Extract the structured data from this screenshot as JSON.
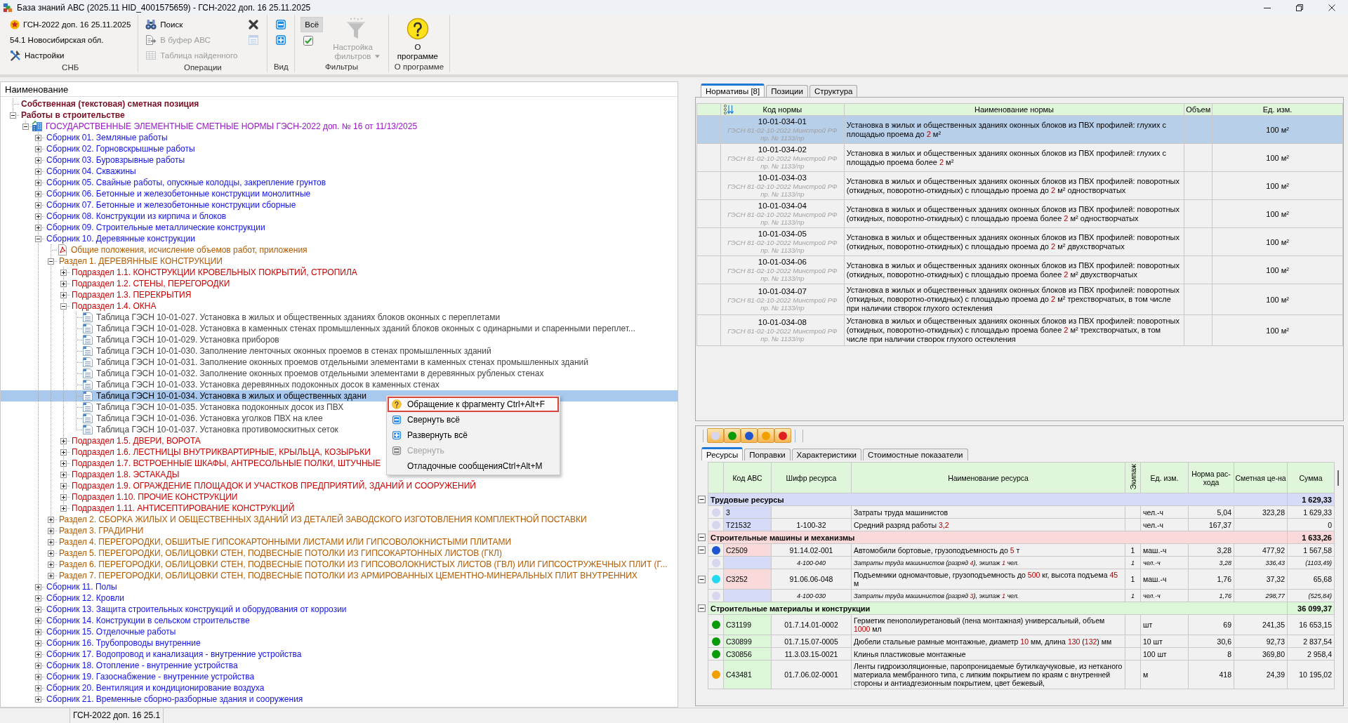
{
  "window": {
    "title": "База знаний АВС (2025.11 HID_4001575659) - ГСН-2022 доп. 16 25.11.2025"
  },
  "ribbon": {
    "groups": [
      {
        "label": "СНБ",
        "columns": [
          {
            "items": [
              {
                "kind": "info",
                "text": "ГСН-2022 доп. 16 25.11.2025",
                "disabled": false
              },
              {
                "kind": "info",
                "text": "54.1 Новосибирская обл.",
                "disabled": false
              },
              {
                "kind": "small",
                "text": "Настройки",
                "disabled": false
              }
            ]
          }
        ]
      },
      {
        "label": "Операции",
        "columns": [
          {
            "items": [
              {
                "kind": "small",
                "text": "Поиск",
                "disabled": false
              },
              {
                "kind": "small",
                "text": "В буфер АВС",
                "disabled": true
              },
              {
                "kind": "small",
                "text": "Таблица найденного",
                "disabled": true
              }
            ]
          },
          {
            "items": [
              {
                "kind": "icon",
                "disabled": false
              },
              {
                "kind": "icon",
                "disabled": true
              }
            ]
          }
        ]
      },
      {
        "label": "Вид",
        "columns": [
          {
            "items": [
              {
                "kind": "icon",
                "disabled": false
              },
              {
                "kind": "icon",
                "disabled": false
              }
            ]
          }
        ]
      },
      {
        "label": "Фильтры",
        "columns": [
          {
            "items": [
              {
                "kind": "toggle",
                "text": "Всё",
                "pressed": true,
                "disabled": false
              },
              {
                "kind": "icon",
                "disabled": false
              }
            ]
          },
          {
            "items": [
              {
                "kind": "large",
                "text": "Настройка фильтров",
                "dropdown": true,
                "disabled": true
              }
            ]
          }
        ]
      },
      {
        "label": "О программе",
        "columns": [
          {
            "items": [
              {
                "kind": "large",
                "text": "О программе",
                "dropdown": false,
                "disabled": false
              }
            ]
          }
        ]
      }
    ]
  },
  "tree": {
    "header": "Наименование",
    "items": [
      {
        "kind": "top",
        "text": "Собственная (текстовая) сметная позиция",
        "selected": false
      },
      {
        "kind": "top",
        "text": "Работы в строительстве",
        "expanded": true,
        "selected": false,
        "children": [
          {
            "kind": "norms",
            "text": "ГОСУДАРСТВЕННЫЕ ЭЛЕМЕНТНЫЕ СМЕТНЫЕ НОРМЫ ГЭСН-2022 доп. № 16 от 11/13/2025",
            "expanded": true,
            "selected": false,
            "children": [
              {
                "kind": "collection",
                "text": "Сборник 01. Земляные работы",
                "expanded": false,
                "selected": false
              },
              {
                "kind": "collection",
                "text": "Сборник 02. Горновскрышные работы",
                "expanded": false,
                "selected": false
              },
              {
                "kind": "collection",
                "text": "Сборник 03. Буровзрывные работы",
                "expanded": false,
                "selected": false
              },
              {
                "kind": "collection",
                "text": "Сборник 04. Скважины",
                "expanded": false,
                "selected": false
              },
              {
                "kind": "collection",
                "text": "Сборник 05. Свайные работы, опускные колодцы, закрепление грунтов",
                "expanded": false,
                "selected": false
              },
              {
                "kind": "collection",
                "text": "Сборник 06. Бетонные и железобетонные конструкции монолитные",
                "expanded": false,
                "selected": false
              },
              {
                "kind": "collection",
                "text": "Сборник 07. Бетонные и железобетонные конструкции сборные",
                "expanded": false,
                "selected": false
              },
              {
                "kind": "collection",
                "text": "Сборник 08. Конструкции из кирпича и блоков",
                "expanded": false,
                "selected": false
              },
              {
                "kind": "collection",
                "text": "Сборник 09. Строительные металлические конструкции",
                "expanded": false,
                "selected": false
              },
              {
                "kind": "collection",
                "text": "Сборник 10. Деревянные конструкции",
                "expanded": true,
                "selected": false,
                "children": [
                  {
                    "kind": "general",
                    "text": "Общие положения, исчисление объемов работ, приложения",
                    "selected": false
                  },
                  {
                    "kind": "section",
                    "text": "Раздел 1. ДЕРЕВЯННЫЕ КОНСТРУКЦИИ",
                    "expanded": true,
                    "selected": false,
                    "children": [
                      {
                        "kind": "subsection",
                        "text": "Подраздел 1.1. КОНСТРУКЦИИ КРОВЕЛЬНЫХ ПОКРЫТИЙ, СТРОПИЛА",
                        "expanded": false,
                        "selected": false
                      },
                      {
                        "kind": "subsection",
                        "text": "Подраздел 1.2. СТЕНЫ, ПЕРЕГОРОДКИ",
                        "expanded": false,
                        "selected": false
                      },
                      {
                        "kind": "subsection",
                        "text": "Подраздел 1.3. ПЕРЕКРЫТИЯ",
                        "expanded": false,
                        "selected": false
                      },
                      {
                        "kind": "subsection",
                        "text": "Подраздел 1.4. ОКНА",
                        "expanded": true,
                        "selected": false,
                        "children": [
                          {
                            "kind": "table",
                            "text": "Таблица ГЭСН 10-01-027. Установка в жилых и общественных зданиях блоков оконных с переплетами",
                            "selected": false
                          },
                          {
                            "kind": "table",
                            "text": "Таблица ГЭСН 10-01-028. Установка в каменных стенах промышленных зданий блоков оконных с одинарными и спаренными переплет...",
                            "selected": false
                          },
                          {
                            "kind": "table",
                            "text": "Таблица ГЭСН 10-01-029. Установка приборов",
                            "selected": false
                          },
                          {
                            "kind": "table",
                            "text": "Таблица ГЭСН 10-01-030. Заполнение ленточных оконных проемов в стенах промышленных зданий",
                            "selected": false
                          },
                          {
                            "kind": "table",
                            "text": "Таблица ГЭСН 10-01-031. Заполнение оконных проемов отдельными элементами в каменных стенах промышленных зданий",
                            "selected": false
                          },
                          {
                            "kind": "table",
                            "text": "Таблица ГЭСН 10-01-032. Заполнение оконных проемов отдельными элементами в деревянных рубленых стенах",
                            "selected": false
                          },
                          {
                            "kind": "table",
                            "text": "Таблица ГЭСН 10-01-033. Установка деревянных подоконных досок в каменных стенах",
                            "selected": false
                          },
                          {
                            "kind": "table",
                            "text": "Таблица ГЭСН 10-01-034. Установка в жилых и общественных здани",
                            "selected": true
                          },
                          {
                            "kind": "table",
                            "text": "Таблица ГЭСН 10-01-035. Установка подоконных досок из ПВХ",
                            "selected": false
                          },
                          {
                            "kind": "table",
                            "text": "Таблица ГЭСН 10-01-036. Установка уголков ПВХ на клее",
                            "selected": false
                          },
                          {
                            "kind": "table",
                            "text": "Таблица ГЭСН 10-01-037. Установка противомоскитных сеток",
                            "selected": false
                          }
                        ]
                      },
                      {
                        "kind": "subsection",
                        "text": "Подраздел 1.5. ДВЕРИ, ВОРОТА",
                        "expanded": false,
                        "selected": false
                      },
                      {
                        "kind": "subsection",
                        "text": "Подраздел 1.6. ЛЕСТНИЦЫ ВНУТРИКВАРТИРНЫЕ, КРЫЛЬЦА, КОЗЫРЬКИ",
                        "expanded": false,
                        "selected": false
                      },
                      {
                        "kind": "subsection",
                        "text": "Подраздел 1.7. ВСТРОЕННЫЕ ШКАФЫ, АНТРЕСОЛЬНЫЕ ПОЛКИ, ШТУЧНЫЕ",
                        "expanded": false,
                        "selected": false
                      },
                      {
                        "kind": "subsection",
                        "text": "Подраздел 1.8. ЭСТАКАДЫ",
                        "expanded": false,
                        "selected": false
                      },
                      {
                        "kind": "subsection",
                        "text": "Подраздел 1.9. ОГРАЖДЕНИЕ ПЛОЩАДОК И УЧАСТКОВ ПРЕДПРИЯТИЙ, ЗДАНИЙ И СООРУЖЕНИЙ",
                        "expanded": false,
                        "selected": false
                      },
                      {
                        "kind": "subsection",
                        "text": "Подраздел 1.10. ПРОЧИЕ КОНСТРУКЦИИ",
                        "expanded": false,
                        "selected": false
                      },
                      {
                        "kind": "subsection",
                        "text": "Подраздел 1.11. АНТИСЕПТИРОВАНИЕ КОНСТРУКЦИЙ",
                        "expanded": false,
                        "selected": false
                      }
                    ]
                  },
                  {
                    "kind": "section",
                    "text": "Раздел 2. СБОРКА ЖИЛЫХ И ОБЩЕСТВЕННЫХ ЗДАНИЙ ИЗ ДЕТАЛЕЙ ЗАВОДСКОГО ИЗГОТОВЛЕНИЯ КОМПЛЕКТНОЙ ПОСТАВКИ",
                    "expanded": false,
                    "selected": false
                  },
                  {
                    "kind": "section",
                    "text": "Раздел 3. ГРАДИРНИ",
                    "expanded": false,
                    "selected": false
                  },
                  {
                    "kind": "section",
                    "text": "Раздел 4. ПЕРЕГОРОДКИ, ОБШИТЫЕ ГИПСОКАРТОННЫМИ ЛИСТАМИ ИЛИ ГИПСОВОЛОКНИСТЫМИ ПЛИТАМИ",
                    "expanded": false,
                    "selected": false
                  },
                  {
                    "kind": "section",
                    "text": "Раздел 5. ПЕРЕГОРОДКИ, ОБЛИЦОВКИ СТЕН, ПОДВЕСНЫЕ ПОТОЛКИ ИЗ ГИПСОКАРТОННЫХ ЛИСТОВ (ГКЛ)",
                    "expanded": false,
                    "selected": false
                  },
                  {
                    "kind": "section",
                    "text": "Раздел 6. ПЕРЕГОРОДКИ, ОБЛИЦОВКИ СТЕН, ПОДВЕСНЫЕ ПОТОЛКИ ИЗ ГИПСОВОЛОКНИСТЫХ ЛИСТОВ (ГВЛ) ИЛИ ГИПСОСТРУЖЕЧНЫХ ПЛИТ (Г...",
                    "expanded": false,
                    "selected": false
                  },
                  {
                    "kind": "section",
                    "text": "Раздел 7. ПЕРЕГОРОДКИ, ОБЛИЦОВКИ СТЕН, ПОДВЕСНЫЕ ПОТОЛКИ ИЗ АРМИРОВАННЫХ ЦЕМЕНТНО-МИНЕРАЛЬНЫХ ПЛИТ ВНУТРЕННИХ",
                    "expanded": false,
                    "selected": false
                  }
                ]
              },
              {
                "kind": "collection",
                "text": "Сборник 11. Полы",
                "expanded": false,
                "selected": false
              },
              {
                "kind": "collection",
                "text": "Сборник 12. Кровли",
                "expanded": false,
                "selected": false
              },
              {
                "kind": "collection",
                "text": "Сборник 13. Защита строительных конструкций и оборудования от коррозии",
                "expanded": false,
                "selected": false
              },
              {
                "kind": "collection",
                "text": "Сборник 14. Конструкции в сельском строительстве",
                "expanded": false,
                "selected": false
              },
              {
                "kind": "collection",
                "text": "Сборник 15. Отделочные работы",
                "expanded": false,
                "selected": false
              },
              {
                "kind": "collection",
                "text": "Сборник 16. Трубопроводы внутренние",
                "expanded": false,
                "selected": false
              },
              {
                "kind": "collection",
                "text": "Сборник 17. Водопровод и канализация - внутренние устройства",
                "expanded": false,
                "selected": false
              },
              {
                "kind": "collection",
                "text": "Сборник 18. Отопление - внутренние устройства",
                "expanded": false,
                "selected": false
              },
              {
                "kind": "collection",
                "text": "Сборник 19. Газоснабжение - внутренние устройства",
                "expanded": false,
                "selected": false
              },
              {
                "kind": "collection",
                "text": "Сборник 20. Вентиляция и кондиционирование воздуха",
                "expanded": false,
                "selected": false
              },
              {
                "kind": "collection",
                "text": "Сборник 21. Временные сборно-разборные здания и сооружения",
                "expanded": false,
                "selected": false
              }
            ]
          }
        ]
      }
    ]
  },
  "context_menu": {
    "items": [
      {
        "text": "Обращение к фрагменту Ctrl+Alt+F",
        "selected": true,
        "disabled": false
      },
      {
        "text": "Свернуть всё",
        "selected": false,
        "disabled": false
      },
      {
        "text": "Развернуть всё",
        "selected": false,
        "disabled": false
      },
      {
        "text": "Свернуть",
        "selected": false,
        "disabled": true
      },
      {
        "text": "Отладочные сообщенияCtrl+Alt+M",
        "selected": false,
        "disabled": false
      }
    ]
  },
  "norm_tabs": [
    {
      "label": "Нормативы [8]",
      "selected": true
    },
    {
      "label": "Позиции",
      "selected": false
    },
    {
      "label": "Структура",
      "selected": false
    }
  ],
  "norms_table": {
    "columns": [
      "Код нормы",
      "Наименование нормы",
      "Объем",
      "Ед. изм."
    ],
    "rows": [
      {
        "code": "10-01-034-01",
        "source": "ГЭСН 81-02-10-2022 Минстрой РФ пр. № 1133/пр",
        "name": [
          "Установка в жилых и общественных зданиях оконных блоков из ПВХ профилей: глухих с площадью проема до ",
          "2",
          " м²"
        ],
        "unit": "100 м²",
        "selected": true
      },
      {
        "code": "10-01-034-02",
        "source": "ГЭСН 81-02-10-2022 Минстрой РФ пр. № 1133/пр",
        "name": [
          "Установка в жилых и общественных зданиях оконных блоков из ПВХ профилей: глухих с площадью проема более ",
          "2",
          " м²"
        ],
        "unit": "100 м²",
        "selected": false
      },
      {
        "code": "10-01-034-03",
        "source": "ГЭСН 81-02-10-2022 Минстрой РФ пр. № 1133/пр",
        "name": [
          "Установка в жилых и общественных зданиях оконных блоков из ПВХ профилей: поворотных (откидных, поворотно-откидных) с площадью проема до ",
          "2",
          " м² одностворчатых"
        ],
        "unit": "100 м²",
        "selected": false
      },
      {
        "code": "10-01-034-04",
        "source": "ГЭСН 81-02-10-2022 Минстрой РФ пр. № 1133/пр",
        "name": [
          "Установка в жилых и общественных зданиях оконных блоков из ПВХ профилей: поворотных (откидных, поворотно-откидных) с площадью проема более ",
          "2",
          " м² одностворчатых"
        ],
        "unit": "100 м²",
        "selected": false
      },
      {
        "code": "10-01-034-05",
        "source": "ГЭСН 81-02-10-2022 Минстрой РФ пр. № 1133/пр",
        "name": [
          "Установка в жилых и общественных зданиях оконных блоков из ПВХ профилей: поворотных (откидных, поворотно-откидных) с площадью проема до ",
          "2",
          " м² двухстворчатых"
        ],
        "unit": "100 м²",
        "selected": false
      },
      {
        "code": "10-01-034-06",
        "source": "ГЭСН 81-02-10-2022 Минстрой РФ пр. № 1133/пр",
        "name": [
          "Установка в жилых и общественных зданиях оконных блоков из ПВХ профилей: поворотных (откидных, поворотно-откидных) с площадью проема более ",
          "2",
          " м² двухстворчатых"
        ],
        "unit": "100 м²",
        "selected": false
      },
      {
        "code": "10-01-034-07",
        "source": "ГЭСН 81-02-10-2022 Минстрой РФ пр. № 1133/пр",
        "name": [
          "Установка в жилых и общественных зданиях оконных блоков из ПВХ профилей: поворотных (откидных, поворотно-откидных) с площадью проема до ",
          "2",
          " м² трехстворчатых, в том числе при наличии створок глухого остекления"
        ],
        "unit": "100 м²",
        "selected": false
      },
      {
        "code": "10-01-034-08",
        "source": "ГЭСН 81-02-10-2022 Минстрой РФ пр. № 1133/пр",
        "name": [
          "Установка в жилых и общественных зданиях оконных блоков из ПВХ профилей: поворотных (откидных, поворотно-откидных) с площадью проема более ",
          "2",
          " м² трехстворчатых, в том числе при наличии створок глухого остекления"
        ],
        "unit": "100 м²",
        "selected": false
      }
    ]
  },
  "color_buttons": [
    {
      "color": "#d6d6ee",
      "on": true
    },
    {
      "color": "#0a9a0a",
      "on": true
    },
    {
      "color": "#1f55d0",
      "on": true
    },
    {
      "color": "#f2a000",
      "on": true
    },
    {
      "color": "#e02020",
      "on": true
    }
  ],
  "resource_tabs": [
    {
      "label": "Ресурсы",
      "selected": true
    },
    {
      "label": "Поправки",
      "selected": false
    },
    {
      "label": "Характеристики",
      "selected": false
    },
    {
      "label": "Стоимостные показатели",
      "selected": false
    }
  ],
  "resources_table": {
    "columns": [
      "Код АВС",
      "Шифр ресурса",
      "Наименование ресурса",
      "Экипаж",
      "Ед. изм.",
      "Норма рас-хода",
      "Сметная це-на",
      "Сумма"
    ],
    "groups": [
      {
        "kind": "labor",
        "title": "Трудовые ресурсы",
        "total": "1 629,33",
        "expanded": true,
        "rows": [
          {
            "kind": "labor",
            "color": "#d6d6ee",
            "code": "3",
            "name": [
              "Затраты труда машинистов"
            ],
            "unit": "чел.-ч",
            "norm": "5,04",
            "price": "323,28",
            "sum": "1 629,33"
          },
          {
            "kind": "labor",
            "color": "#d6d6ee",
            "code": "Т21532",
            "cipher": "1-100-32",
            "name": [
              "Средний разряд работы ",
              "3,2"
            ],
            "unit": "чел.-ч",
            "norm": "167,37",
            "sum": "0"
          }
        ]
      },
      {
        "kind": "machine",
        "title": "Строительные машины и механизмы",
        "total": "1 633,26",
        "expanded": true,
        "rows": [
          {
            "kind": "machine",
            "color": "#1f55d0",
            "code": "С2509",
            "cipher": "91.14.02-001",
            "name": [
              "Автомобили бортовые, грузоподъемность до ",
              "5",
              " т"
            ],
            "crew": "1",
            "unit": "маш.-ч",
            "norm": "3,28",
            "price": "477,92",
            "sum": "1 567,58",
            "expanded": true,
            "children": [
              {
                "kind": "crew",
                "color": "#d6d6ee",
                "cipher": "4-100-040",
                "name": [
                  "Затраты труда машинистов (разряд ",
                  "4",
                  "), экипаж ",
                  "1",
                  " чел."
                ],
                "crew": "1",
                "unit": "чел.-ч",
                "norm": "3,28",
                "price": "336,43",
                "sum": "(1103,49)"
              }
            ]
          },
          {
            "kind": "machine",
            "color": "#22d8f2",
            "code": "С3252",
            "cipher": "91.06.06-048",
            "name": [
              "Подъемники одномачтовые, грузоподъемность до ",
              "500",
              " кг, высота подъема ",
              "45",
              " м"
            ],
            "crew": "1",
            "unit": "маш.-ч",
            "norm": "1,76",
            "price": "37,32",
            "sum": "65,68",
            "expanded": true,
            "children": [
              {
                "kind": "crew",
                "color": "#d6d6ee",
                "cipher": "4-100-030",
                "name": [
                  "Затраты труда машинистов (разряд ",
                  "3",
                  "), экипаж ",
                  "1",
                  " чел."
                ],
                "crew": "1",
                "unit": "чел.-ч",
                "norm": "1,76",
                "price": "298,77",
                "sum": "(525,84)"
              }
            ]
          }
        ]
      },
      {
        "kind": "material",
        "title": "Строительные материалы и конструкции",
        "total": "36 099,37",
        "expanded": true,
        "rows": [
          {
            "kind": "material",
            "color": "#0a9a0a",
            "code": "С31199",
            "cipher": "01.7.14.01-0002",
            "name": [
              "Герметик пенополиуретановый (пена монтажная) универсальный, объем ",
              "1000",
              " мл"
            ],
            "unit": "шт",
            "norm": "69",
            "price": "241,35",
            "sum": "16 653,15"
          },
          {
            "kind": "material",
            "color": "#0a9a0a",
            "code": "С30899",
            "cipher": "01.7.15.07-0005",
            "name": [
              "Дюбели стальные рамные монтажные, диаметр ",
              "10",
              " мм, длина ",
              "130",
              " (",
              "132",
              ") мм"
            ],
            "unit": "10 шт",
            "norm": "30,6",
            "price": "92,73",
            "sum": "2 837,54"
          },
          {
            "kind": "material",
            "color": "#0a9a0a",
            "code": "С30856",
            "cipher": "11.3.03.15-0021",
            "name": [
              "Клинья пластиковые монтажные"
            ],
            "unit": "100 шт",
            "norm": "8",
            "price": "369,80",
            "sum": "2 958,4"
          },
          {
            "kind": "material",
            "color": "#f2a000",
            "code": "С43481",
            "cipher": "01.7.06.02-0001",
            "name": [
              "Ленты гидроизоляционные, паропроницаемые бутилкаучуковые, из нетканого материала мембранного типа, с липким покрытием по краям с внутренней стороны и антиадгезионным покрытием, цвет бежевый,"
            ],
            "unit": "м",
            "norm": "418",
            "price": "24,39",
            "sum": "10 195,02"
          }
        ]
      }
    ]
  },
  "status_bar": {
    "text": "ГСН-2022 доп. 16 25.1"
  }
}
